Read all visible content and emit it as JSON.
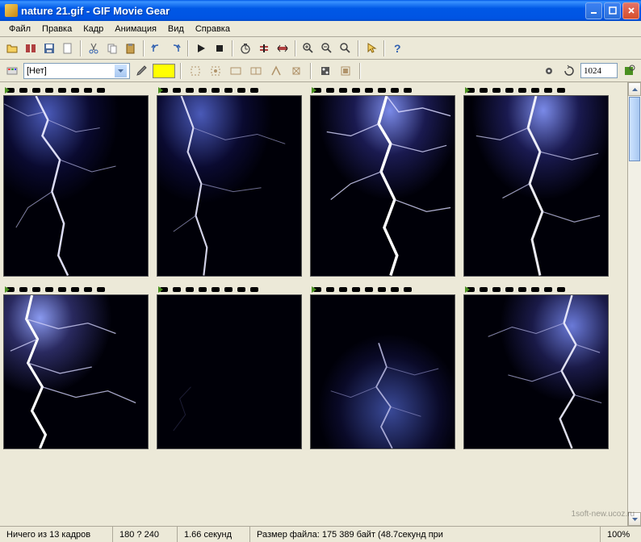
{
  "window": {
    "title": "nature 21.gif - GIF Movie Gear"
  },
  "menu": {
    "items": [
      "Файл",
      "Правка",
      "Кадр",
      "Анимация",
      "Вид",
      "Справка"
    ]
  },
  "toolbar2": {
    "dropdown_value": "[Нет]",
    "rotation_value": "1024"
  },
  "status": {
    "frames": "Ничего из 13 кадров",
    "dimensions": "180 ? 240",
    "duration": "1.66 секунд",
    "filesize": "Размер файла: 175 389 байт  (48.7секунд при",
    "zoom": "100%"
  },
  "watermark": "1soft-new.ucoz.ru"
}
